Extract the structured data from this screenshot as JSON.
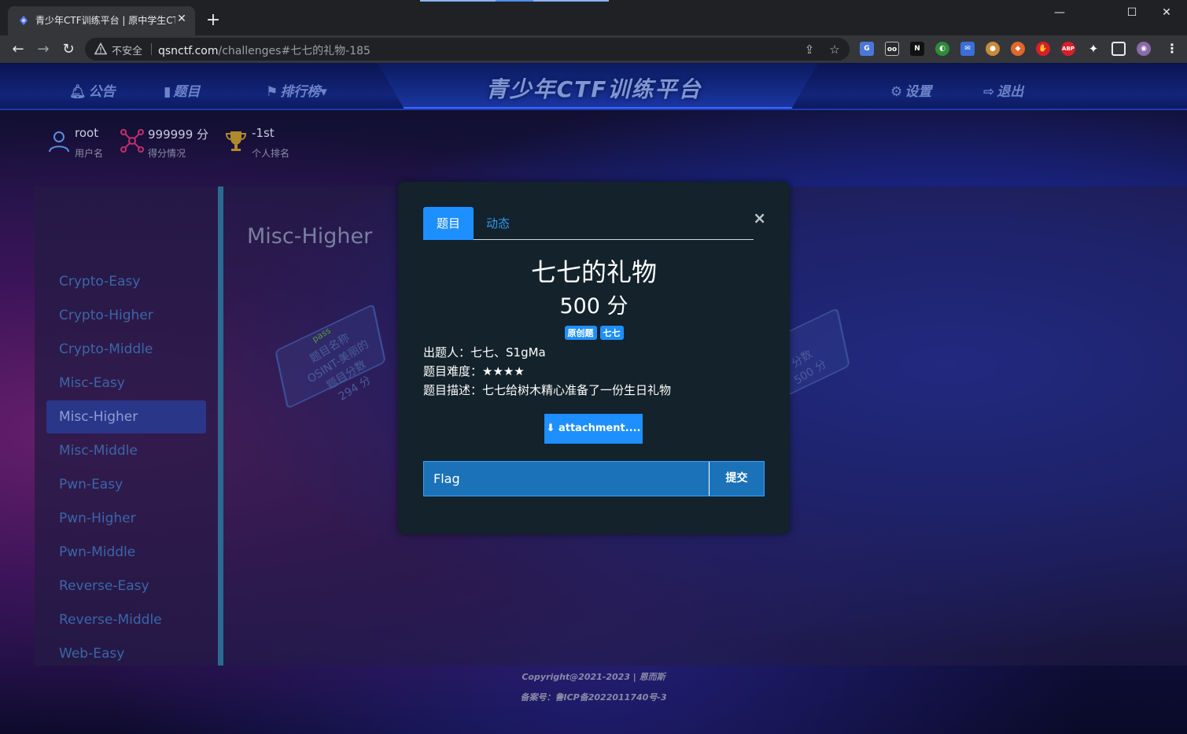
{
  "browser": {
    "tab_title": "青少年CTF训练平台 | 原中学生CTF平台",
    "tab_close": "✕",
    "new_tab": "+",
    "insecure_label": "不安全",
    "url_host": "qsnctf.com",
    "url_path": "/challenges#七七的礼物-185",
    "window_minimize": "—",
    "window_maximize": "☐",
    "window_close": "✕"
  },
  "header": {
    "nav_notice": "公告",
    "nav_challenges": "题目",
    "nav_ranking": "排行榜",
    "site_title": "青少年CTF训练平台",
    "nav_settings": "设置",
    "nav_logout": "退出"
  },
  "user": {
    "username": "root",
    "username_label": "用户名",
    "score": "999999 分",
    "score_label": "得分情况",
    "rank": "-1st",
    "rank_label": "个人排名"
  },
  "sidebar": {
    "items": [
      "Crypto-Easy",
      "Crypto-Higher",
      "Crypto-Middle",
      "Misc-Easy",
      "Misc-Higher",
      "Misc-Middle",
      "Pwn-Easy",
      "Pwn-Higher",
      "Pwn-Middle",
      "Reverse-Easy",
      "Reverse-Middle",
      "Web-Easy"
    ],
    "active_index": 4
  },
  "content": {
    "category_title": "Misc-Higher",
    "card1": {
      "badge": "pass",
      "name_label": "题目名称",
      "name": "OSINT-美丽的",
      "score_label": "题目分数",
      "score": "294 分"
    },
    "card2": {
      "score_label": "分数",
      "score": "500 分"
    }
  },
  "modal": {
    "tab_challenge": "题目",
    "tab_activity": "动态",
    "close": "×",
    "challenge_name": "七七的礼物",
    "challenge_score": "500 分",
    "tags": [
      "原创题",
      "七七"
    ],
    "author": "出题人：七七、S1gMa",
    "difficulty": "题目难度：★★★★",
    "description": "题目描述：七七给树木精心准备了一份生日礼物",
    "attachment_button": "attachment....",
    "flag_placeholder": "Flag",
    "submit_button": "提交"
  },
  "footer": {
    "copyright": "Copyright@2021-2023 | 恩而斯",
    "icp": "备案号：鲁ICP备2022011740号-3"
  },
  "colors": {
    "accent": "#1e8fff",
    "modal_bg": "#13222b",
    "sidebar_active": "#2a3688"
  }
}
